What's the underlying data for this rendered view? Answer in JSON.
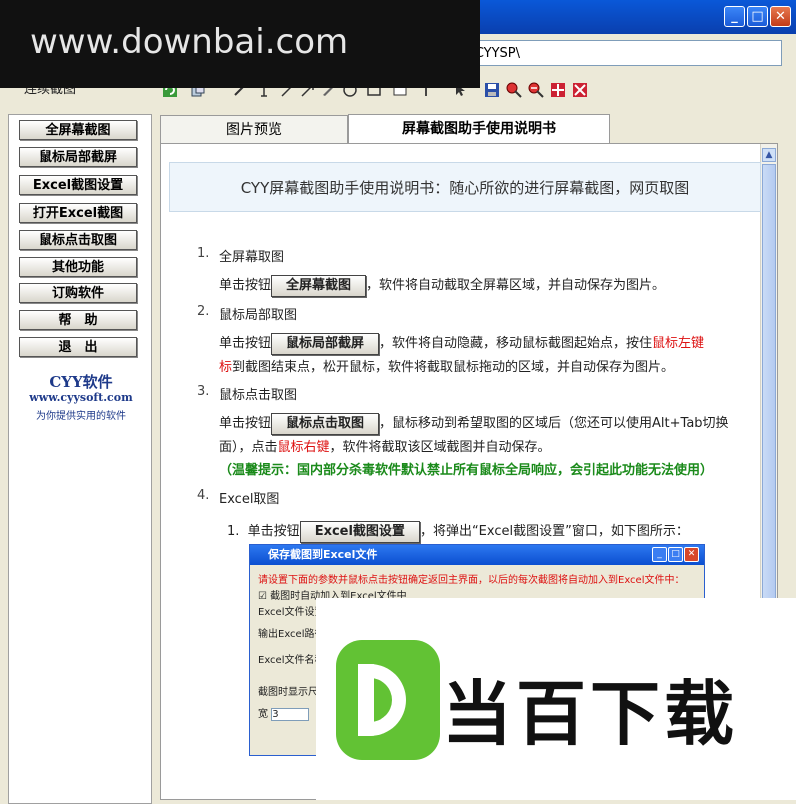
{
  "watermark_top": "www.downbai.com",
  "path_value": "ft\\CYYSP\\",
  "toolbar_label": "连续截图",
  "sidebar": {
    "buttons": [
      "全屏幕截图",
      "鼠标局部截屏",
      "Excel截图设置",
      "打开Excel截图",
      "鼠标点击取图",
      "其他功能",
      "订购软件",
      "帮　助",
      "退　出"
    ],
    "brand_name": "CYY软件",
    "brand_url": "www.cyysoft.com",
    "brand_tagline": "为你提供实用的软件"
  },
  "tabs": [
    "图片预览",
    "屏幕截图助手使用说明书"
  ],
  "doc": {
    "header": "CYY屏幕截图助手使用说明书：随心所欲的进行屏幕截图，网页取图",
    "sections": [
      {
        "num": "1.",
        "title": "全屏幕取图"
      },
      {
        "num": "2.",
        "title": "鼠标局部取图"
      },
      {
        "num": "3.",
        "title": "鼠标点击取图"
      },
      {
        "num": "4.",
        "title": "Excel取图"
      }
    ],
    "s1_pre": "单击按钮",
    "s1_btn": "全屏幕截图",
    "s1_post": "，软件将自动截取全屏幕区域，并自动保存为图片。",
    "s2_pre": "单击按钮",
    "s2_btn": "鼠标局部截屏",
    "s2_mid": "，软件将自动隐藏，移动鼠标截图起始点，按住",
    "s2_red1": "鼠标左键",
    "s2_red2": "标",
    "s2_line2": "到截图结束点，松开鼠标，软件将截取鼠标拖动的区域，并自动保存为图片。",
    "s3_pre": "单击按钮",
    "s3_btn": "鼠标点击取图",
    "s3_post": "，鼠标移动到希望取图的区域后（您还可以使用Alt+Tab切换",
    "s3_line2a": "面），点击",
    "s3_red": "鼠标右键",
    "s3_line2b": "，软件将截取该区域截图并自动保存。",
    "s3_tip": "（温馨提示：国内部分杀毒软件默认禁止所有鼠标全局响应，会引起此功能无法使用）",
    "s4_num": "1.",
    "s4_pre": "单击按钮",
    "s4_btn": "Excel截图设置",
    "s4_post": "，将弹出“Excel截图设置”窗口，如下图所示："
  },
  "subwindow": {
    "title": "保存截图到Excel文件",
    "warning": "请设置下面的参数并鼠标点击按钮确定返回主界面，以后的每次截图将自动加入到Excel文件中：",
    "checkbox": "截图时自动加入到Excel文件中",
    "group": "Excel文件设置",
    "field1": "输出Excel路径",
    "field2": "Excel文件名称",
    "group2": "截图时显示尺寸",
    "input_value": "3"
  },
  "watermark_br": "当百下载",
  "colors": {
    "titlebar": "#0a4fd0",
    "accent_red": "#d11111",
    "tip_green": "#1a8a1a",
    "logo_green": "#62c234"
  }
}
